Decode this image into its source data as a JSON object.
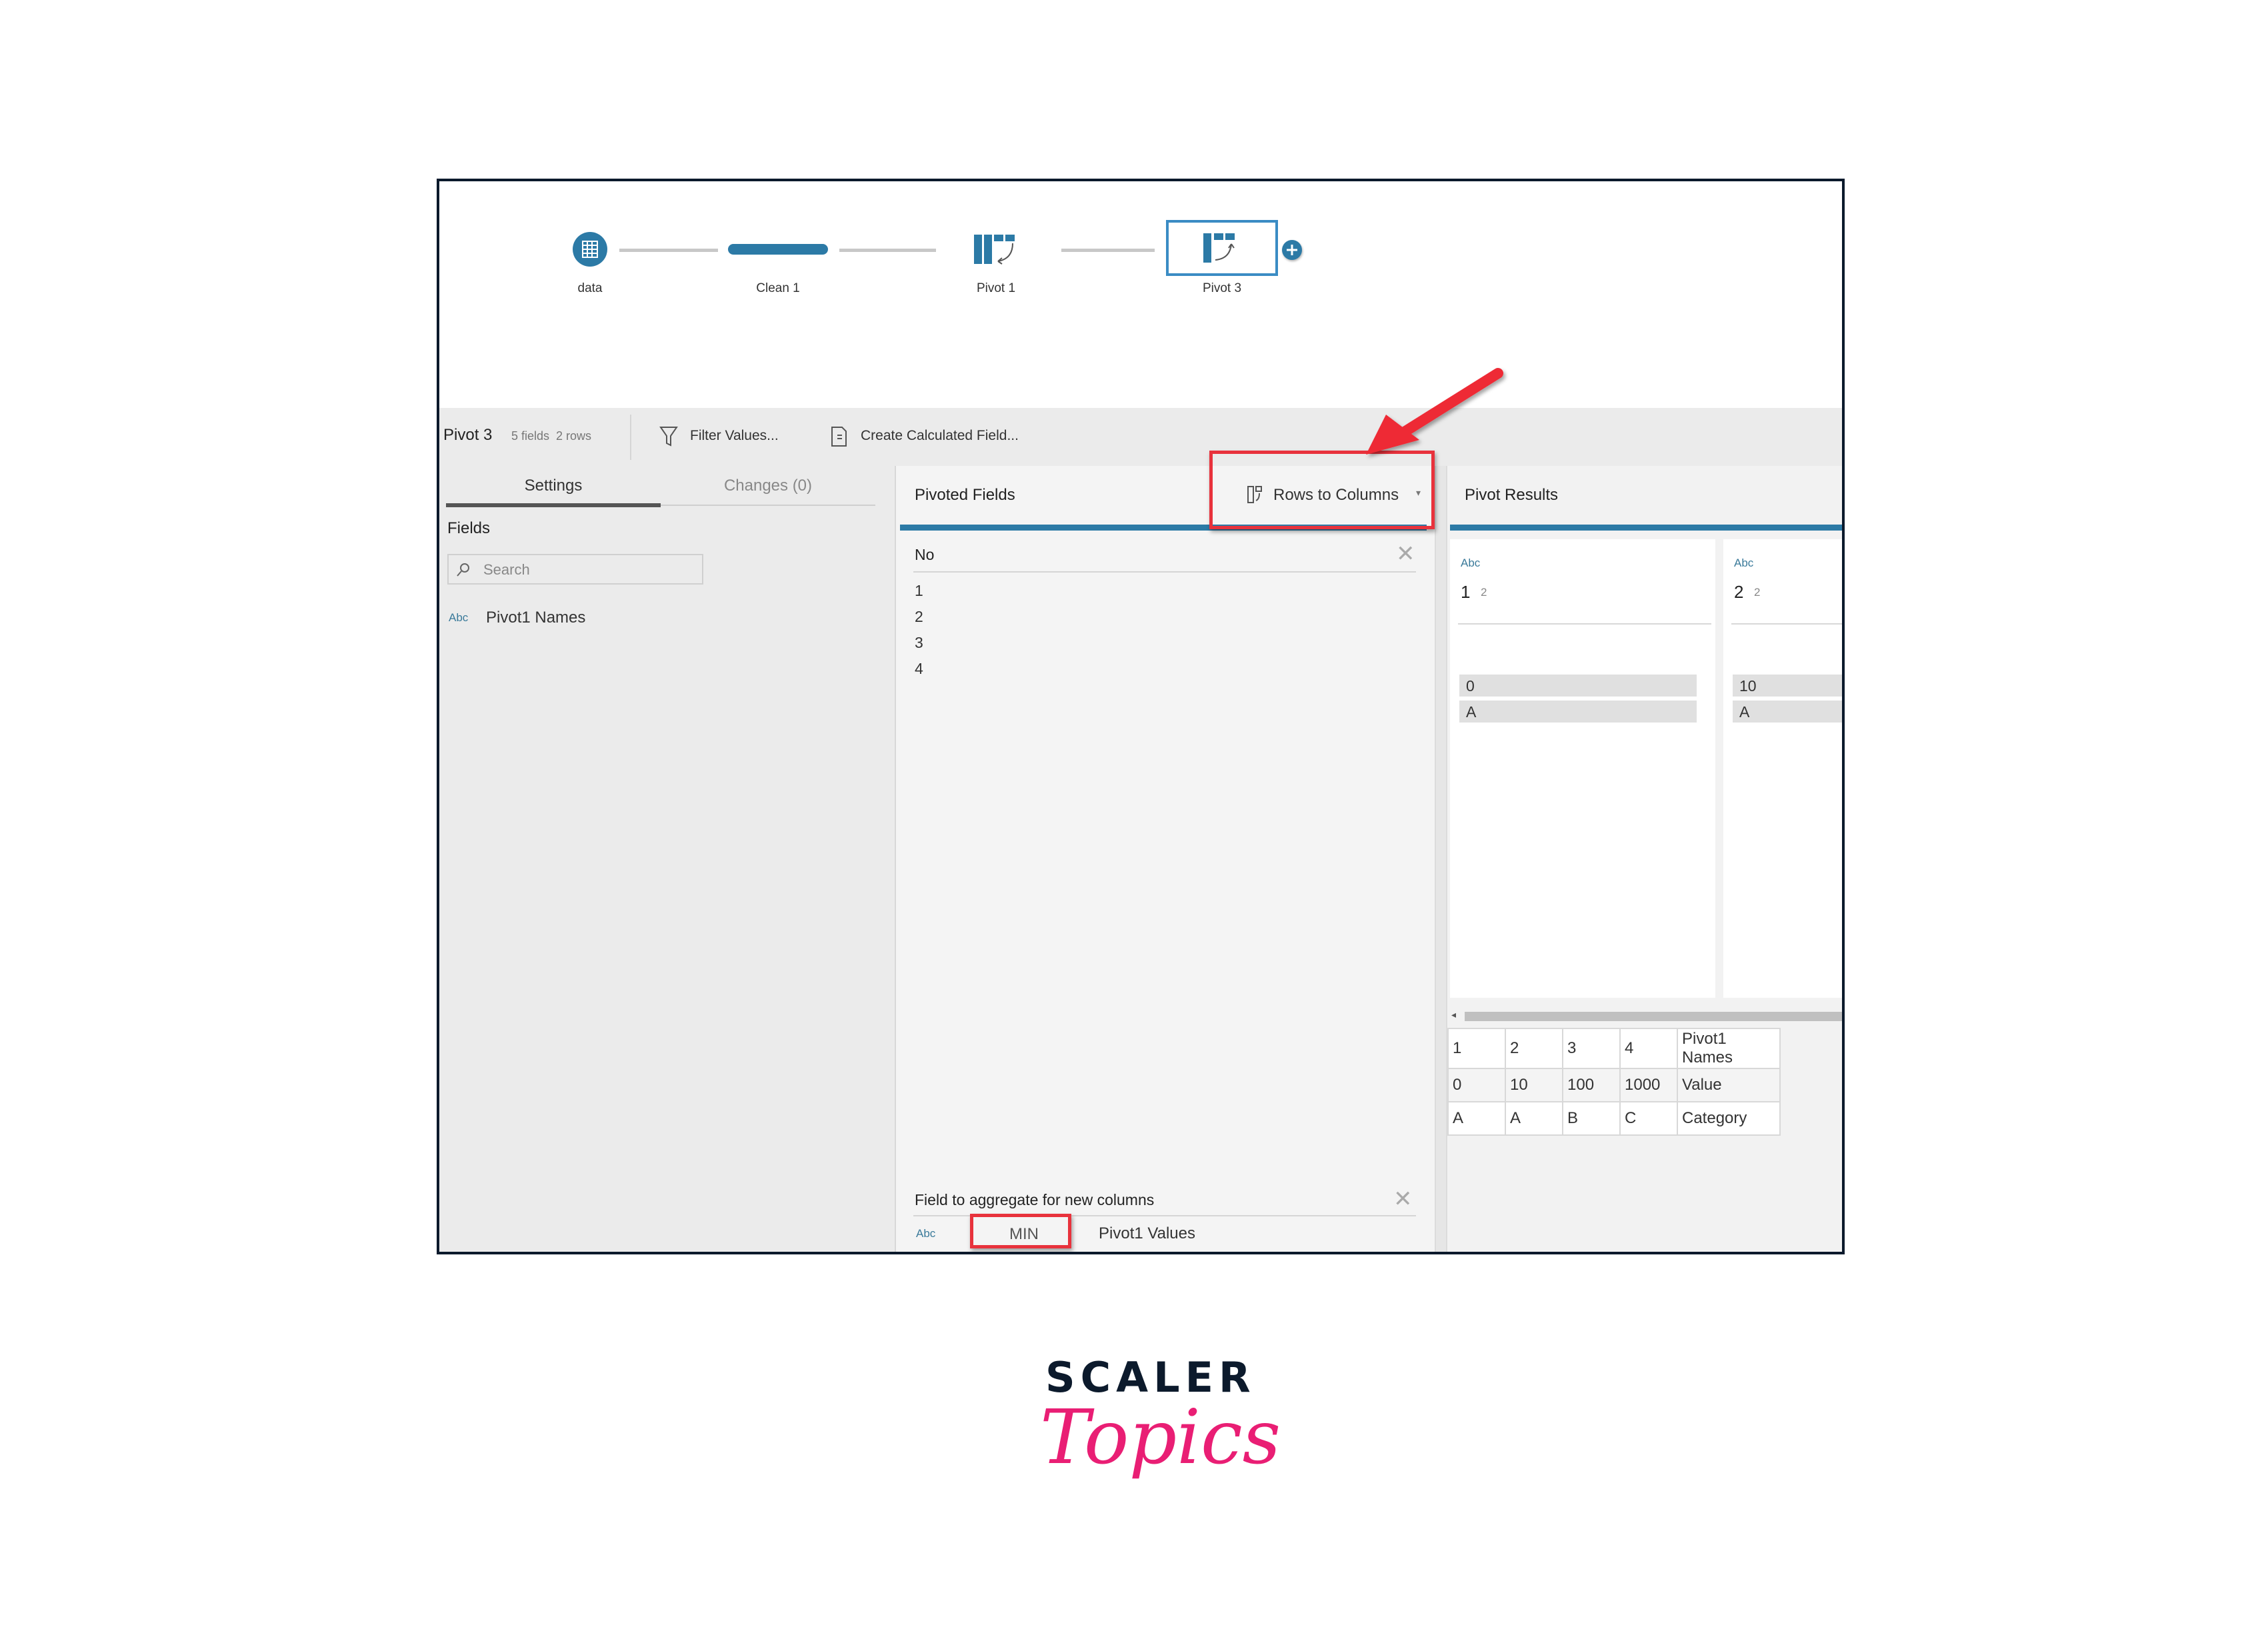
{
  "flow": {
    "nodes": [
      {
        "label": "data",
        "icon": "table-icon"
      },
      {
        "label": "Clean 1",
        "icon": "clean-bar-icon"
      },
      {
        "label": "Pivot 1",
        "icon": "pivot-columns-to-rows-icon"
      },
      {
        "label": "Pivot 3",
        "icon": "pivot-rows-to-columns-icon",
        "selected": true
      }
    ],
    "add_button_icon": "plus-icon"
  },
  "toolbar": {
    "step_name": "Pivot 3",
    "step_meta": "5 fields  2 rows",
    "filter_label": "Filter Values...",
    "calc_label": "Create Calculated Field..."
  },
  "left_panel": {
    "tabs": [
      {
        "label": "Settings",
        "active": true
      },
      {
        "label": "Changes (0)",
        "active": false
      }
    ],
    "fields_heading": "Fields",
    "search_placeholder": "Search",
    "fields": [
      {
        "type": "Abc",
        "name": "Pivot1 Names"
      }
    ]
  },
  "middle_panel": {
    "title": "Pivoted Fields",
    "pivot_type": "Rows to Columns",
    "pivot_field": {
      "name": "No",
      "values": [
        "1",
        "2",
        "3",
        "4"
      ]
    },
    "aggregate": {
      "heading": "Field to aggregate for new columns",
      "type": "Abc",
      "function": "MIN",
      "field": "Pivot1 Values"
    }
  },
  "right_panel": {
    "title": "Pivot Results",
    "cards": [
      {
        "type": "Abc",
        "name": "1",
        "count": "2",
        "values": [
          "0",
          "A"
        ]
      },
      {
        "type": "Abc",
        "name": "2",
        "count": "2",
        "values": [
          "10",
          "A"
        ]
      }
    ],
    "table": {
      "headers": [
        "1",
        "2",
        "3",
        "4",
        "Pivot1 Names"
      ],
      "rows": [
        [
          "0",
          "10",
          "100",
          "1000",
          "Value"
        ],
        [
          "A",
          "A",
          "B",
          "C",
          "Category"
        ]
      ]
    }
  },
  "annotations": {
    "highlight_color": "#e8323c",
    "accent_color": "#2c7aa6"
  },
  "branding": {
    "line1": "SCALER",
    "line2": "Topics",
    "line1_color": "#0c1a2c",
    "line2_color": "#e91e74"
  }
}
